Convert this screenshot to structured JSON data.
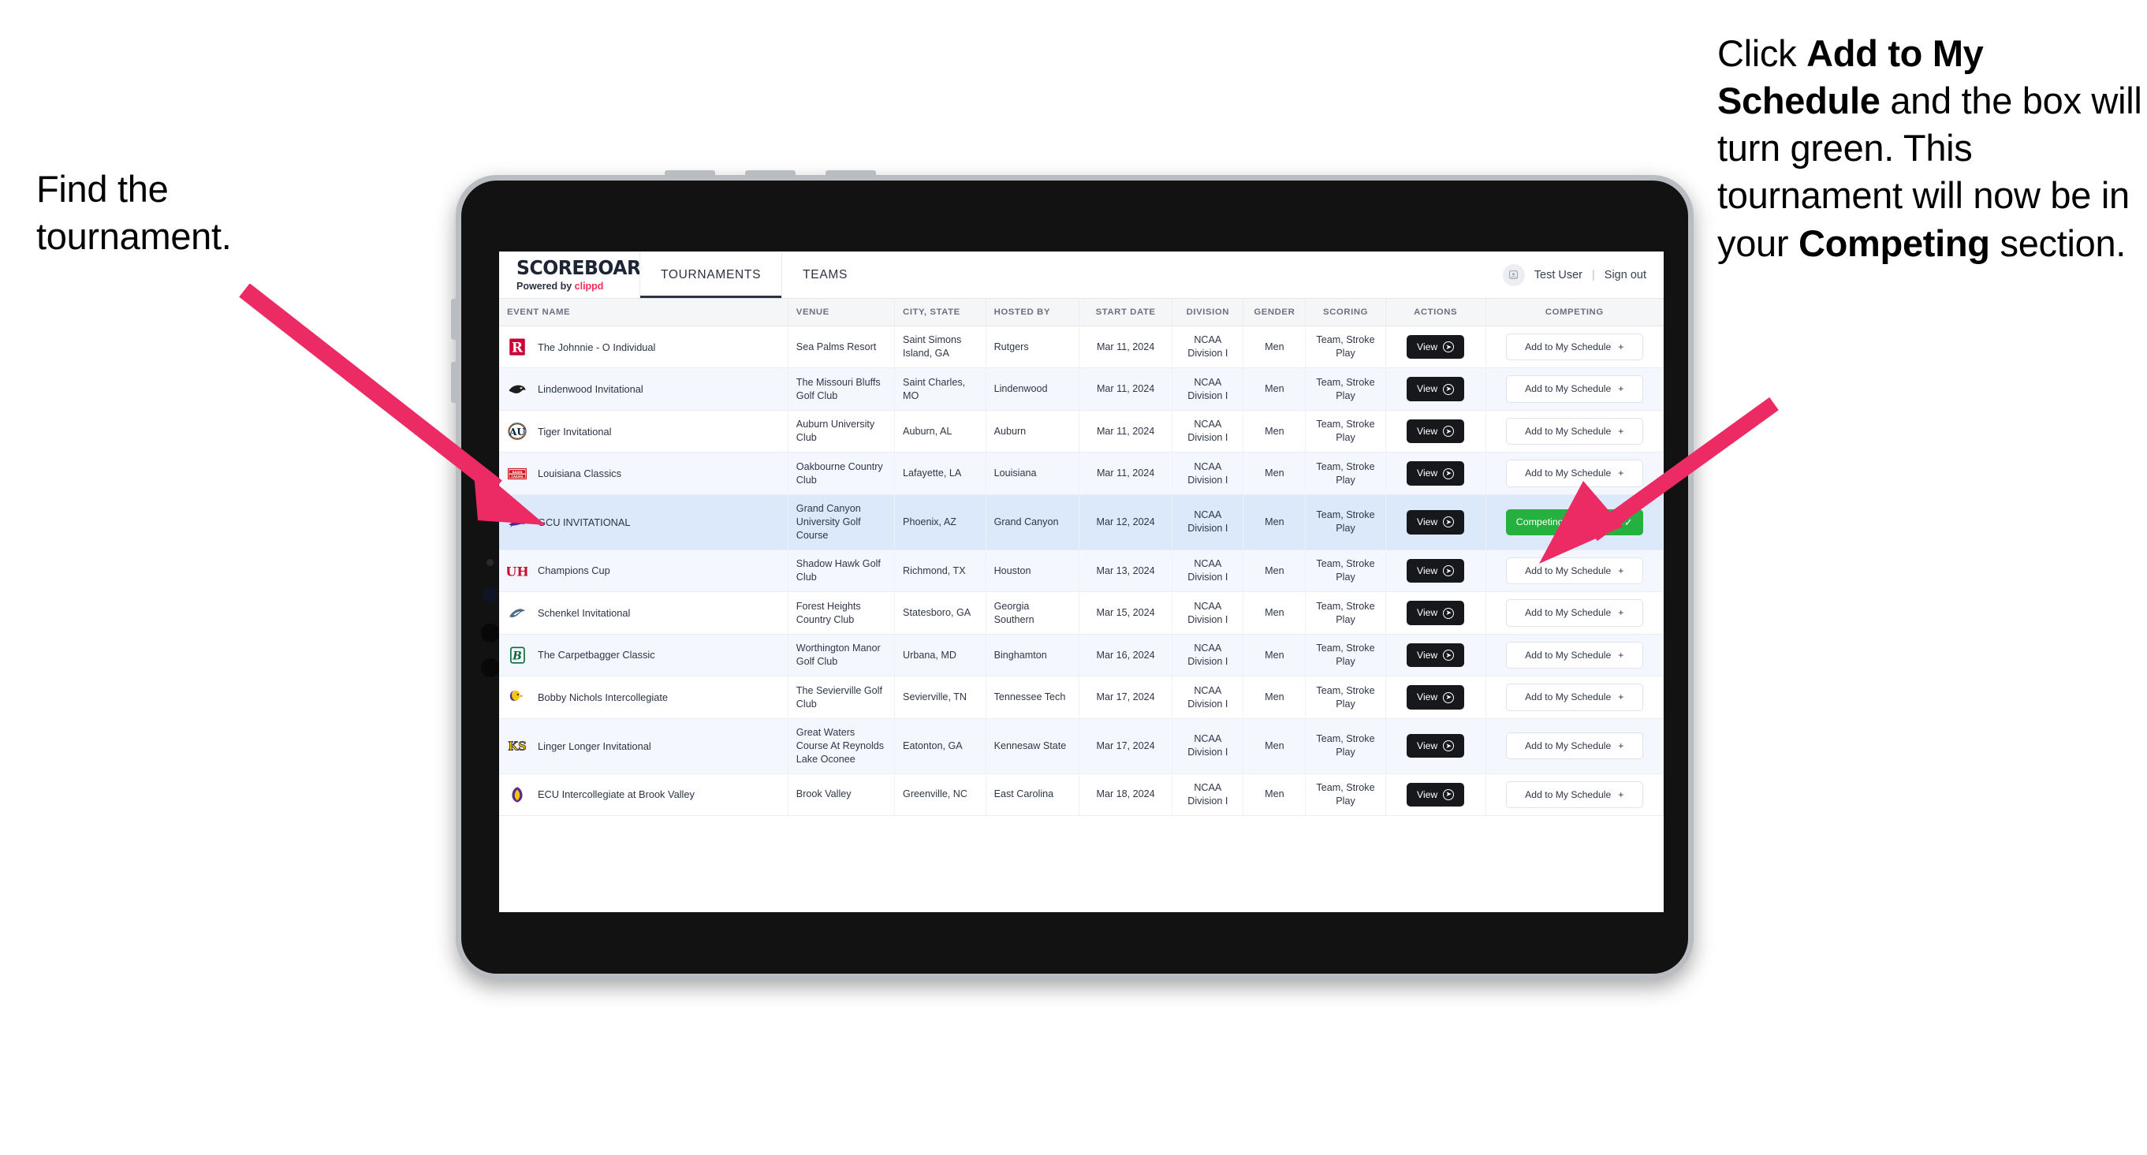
{
  "annotations": {
    "left": {
      "line1": "Find the",
      "line2": "tournament."
    },
    "right": {
      "p1_before": "Click ",
      "p1_bold": "Add to My Schedule",
      "p1_after": " and the box will turn green. This tournament will now be in your ",
      "p2_bold": "Competing",
      "p2_after": " section."
    },
    "arrow_color": "#ec2a63"
  },
  "app": {
    "brand": {
      "wordmark": "SCOREBOARD",
      "powered_prefix": "Powered by ",
      "powered_brand": "clippd",
      "brand_color": "#ef2d56"
    },
    "nav": [
      {
        "label": "TOURNAMENTS",
        "active": true
      },
      {
        "label": "TEAMS",
        "active": false
      }
    ],
    "user": {
      "avatar_icon": "user-avatar-icon",
      "name": "Test User",
      "separator": "|",
      "sign_out": "Sign out"
    },
    "table": {
      "columns": [
        "EVENT NAME",
        "VENUE",
        "CITY, STATE",
        "HOSTED BY",
        "START DATE",
        "DIVISION",
        "GENDER",
        "SCORING",
        "ACTIONS",
        "COMPETING"
      ],
      "view_label": "View",
      "add_label": "Add to My Schedule",
      "add_plus": "+",
      "competing_label": "Competing",
      "competing_check": "✓",
      "competing_color": "#25b03f",
      "rows": [
        {
          "logo": "rutgers-logo",
          "event": "The Johnnie - O Individual",
          "venue": "Sea Palms Resort",
          "city": "Saint Simons Island, GA",
          "host": "Rutgers",
          "date": "Mar 11, 2024",
          "division": "NCAA Division I",
          "gender": "Men",
          "scoring": "Team, Stroke Play",
          "competing": false
        },
        {
          "logo": "lindenwood-logo",
          "event": "Lindenwood Invitational",
          "venue": "The Missouri Bluffs Golf Club",
          "city": "Saint Charles, MO",
          "host": "Lindenwood",
          "date": "Mar 11, 2024",
          "division": "NCAA Division I",
          "gender": "Men",
          "scoring": "Team, Stroke Play",
          "competing": false
        },
        {
          "logo": "auburn-logo",
          "event": "Tiger Invitational",
          "venue": "Auburn University Club",
          "city": "Auburn, AL",
          "host": "Auburn",
          "date": "Mar 11, 2024",
          "division": "NCAA Division I",
          "gender": "Men",
          "scoring": "Team, Stroke Play",
          "competing": false
        },
        {
          "logo": "louisiana-logo",
          "event": "Louisiana Classics",
          "venue": "Oakbourne Country Club",
          "city": "Lafayette, LA",
          "host": "Louisiana",
          "date": "Mar 11, 2024",
          "division": "NCAA Division I",
          "gender": "Men",
          "scoring": "Team, Stroke Play",
          "competing": false
        },
        {
          "logo": "gcu-logo",
          "event": "GCU INVITATIONAL",
          "venue": "Grand Canyon University Golf Course",
          "city": "Phoenix, AZ",
          "host": "Grand Canyon",
          "date": "Mar 12, 2024",
          "division": "NCAA Division I",
          "gender": "Men",
          "scoring": "Team, Stroke Play",
          "competing": true,
          "selected": true
        },
        {
          "logo": "houston-logo",
          "event": "Champions Cup",
          "venue": "Shadow Hawk Golf Club",
          "city": "Richmond, TX",
          "host": "Houston",
          "date": "Mar 13, 2024",
          "division": "NCAA Division I",
          "gender": "Men",
          "scoring": "Team, Stroke Play",
          "competing": false
        },
        {
          "logo": "georgia-southern-logo",
          "event": "Schenkel Invitational",
          "venue": "Forest Heights Country Club",
          "city": "Statesboro, GA",
          "host": "Georgia Southern",
          "date": "Mar 15, 2024",
          "division": "NCAA Division I",
          "gender": "Men",
          "scoring": "Team, Stroke Play",
          "competing": false
        },
        {
          "logo": "binghamton-logo",
          "event": "The Carpetbagger Classic",
          "venue": "Worthington Manor Golf Club",
          "city": "Urbana, MD",
          "host": "Binghamton",
          "date": "Mar 16, 2024",
          "division": "NCAA Division I",
          "gender": "Men",
          "scoring": "Team, Stroke Play",
          "competing": false
        },
        {
          "logo": "tennessee-tech-logo",
          "event": "Bobby Nichols Intercollegiate",
          "venue": "The Sevierville Golf Club",
          "city": "Sevierville, TN",
          "host": "Tennessee Tech",
          "date": "Mar 17, 2024",
          "division": "NCAA Division I",
          "gender": "Men",
          "scoring": "Team, Stroke Play",
          "competing": false
        },
        {
          "logo": "kennesaw-state-logo",
          "event": "Linger Longer Invitational",
          "venue": "Great Waters Course At Reynolds Lake Oconee",
          "city": "Eatonton, GA",
          "host": "Kennesaw State",
          "date": "Mar 17, 2024",
          "division": "NCAA Division I",
          "gender": "Men",
          "scoring": "Team, Stroke Play",
          "competing": false
        },
        {
          "logo": "east-carolina-logo",
          "event": "ECU Intercollegiate at Brook Valley",
          "venue": "Brook Valley",
          "city": "Greenville, NC",
          "host": "East Carolina",
          "date": "Mar 18, 2024",
          "division": "NCAA Division I",
          "gender": "Men",
          "scoring": "Team, Stroke Play",
          "competing": false
        }
      ]
    }
  }
}
